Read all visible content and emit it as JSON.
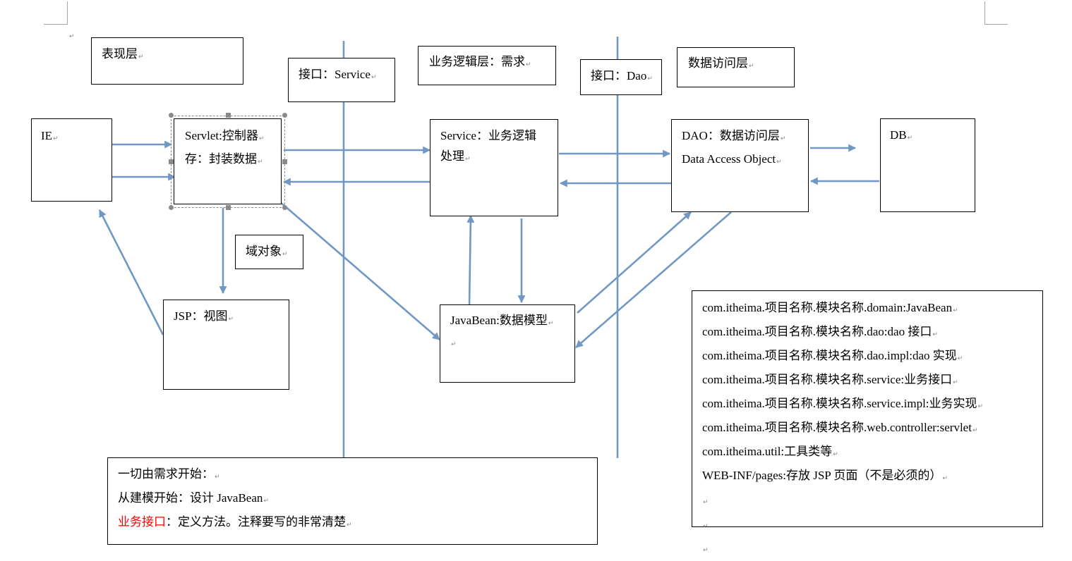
{
  "colors": {
    "arrow": "#6f98c4",
    "box_border": "#000000",
    "highlight_red": "#ff0000"
  },
  "layer_labels": {
    "presentation": "表现层",
    "service_interface": "接口：Service",
    "business_logic": "业务逻辑层：需求",
    "dao_interface": "接口：Dao",
    "data_access": "数据访问层"
  },
  "nodes": {
    "ie": {
      "label": "IE"
    },
    "servlet": {
      "line1": "Servlet:控制器",
      "line2": "存：封装数据"
    },
    "service": {
      "line1": "Service：业务逻辑",
      "line2": "处理"
    },
    "dao": {
      "line1": "DAO：数据访问层",
      "line2": "Data Access Object"
    },
    "db": {
      "label": "DB"
    },
    "domain_object": {
      "label": "域对象"
    },
    "jsp": {
      "label": "JSP：视图"
    },
    "javabean": {
      "label": "JavaBean:数据模型"
    }
  },
  "packages": {
    "lines": [
      "com.itheima.项目名称.模块名称.domain:JavaBean",
      "com.itheima.项目名称.模块名称.dao:dao 接口",
      "com.itheima.项目名称.模块名称.dao.impl:dao 实现",
      "com.itheima.项目名称.模块名称.service:业务接口",
      "com.itheima.项目名称.模块名称.service.impl:业务实现",
      "com.itheima.项目名称.模块名称.web.controller:servlet",
      "com.itheima.util:工具类等",
      "WEB-INF/pages:存放 JSP 页面（不是必须的）"
    ]
  },
  "notes": {
    "line1": "一切由需求开始：",
    "line2": "从建模开始：设计 JavaBean",
    "line3_highlight": "业务接口",
    "line3_rest": "：定义方法。注释要写的非常清楚"
  }
}
